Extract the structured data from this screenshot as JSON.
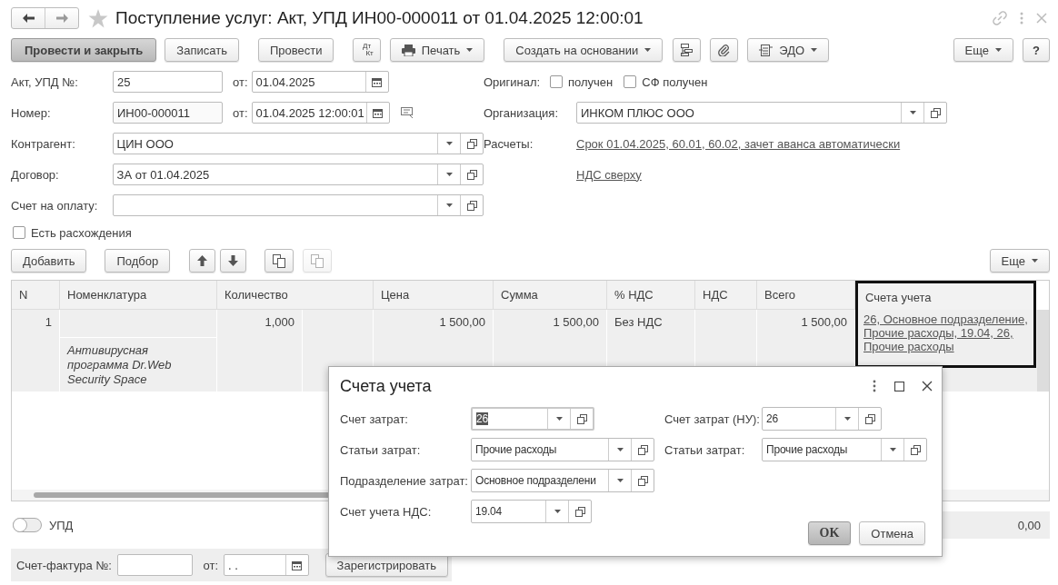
{
  "window": {
    "title": "Поступление услуг: Акт, УПД ИН00-000011 от 01.04.2025 12:00:01"
  },
  "toolbar": [
    {
      "kind": "primary",
      "label": "Провести и закрыть"
    },
    {
      "kind": "button",
      "label": "Записать"
    },
    {
      "kind": "button",
      "label": "Провести"
    },
    {
      "kind": "dtkt",
      "label": "Дт",
      "sublabel": "Кт"
    },
    {
      "kind": "print",
      "label": "Печать"
    },
    {
      "kind": "menu",
      "label": "Создать на основании"
    },
    {
      "kind": "structure"
    },
    {
      "kind": "attach"
    },
    {
      "kind": "edo",
      "label": "ЭДО"
    }
  ],
  "toolbar_right": [
    {
      "kind": "menu",
      "label": "Еще"
    },
    {
      "kind": "button",
      "label": "?"
    }
  ],
  "form_left": [
    {
      "kind": "text",
      "label": "Акт, УПД №:",
      "value": "25",
      "date_label": "от:",
      "date": "01.04.2025"
    },
    {
      "kind": "readonly",
      "label": "Номер:",
      "value": "ИН00-000011",
      "date_label": "от:",
      "date": "01.04.2025 12:00:01"
    },
    {
      "kind": "select",
      "label": "Контрагент:",
      "value": "ЦИН ООО"
    },
    {
      "kind": "select",
      "label": "Договор:",
      "value": "ЗА от 01.04.2025"
    },
    {
      "kind": "select",
      "label": "Счет на оплату:"
    }
  ],
  "form_right": [
    {
      "kind": "checks",
      "label": "Оригинал:",
      "checks": [
        {
          "label": "получен",
          "checked": false
        },
        {
          "label": "СФ получен",
          "checked": false
        }
      ]
    },
    {
      "kind": "select",
      "label": "Организация:",
      "value": "ИНКОМ ПЛЮС ООО"
    },
    {
      "kind": "link",
      "label": "Расчеты:",
      "value": "Срок 01.04.2025, 60.01, 60.02, зачет аванса автоматически"
    },
    {
      "kind": "link",
      "value": "НДС сверху"
    }
  ],
  "discrepancy": {
    "label": "Есть расхождения",
    "checked": false
  },
  "table_toolbar": [
    {
      "kind": "button",
      "label": "Добавить"
    },
    {
      "kind": "button",
      "label": "Подбор"
    },
    {
      "kind": "up"
    },
    {
      "kind": "down"
    },
    {
      "kind": "copy"
    },
    {
      "kind": "paste",
      "disabled": true
    }
  ],
  "table_toolbar_right": {
    "label": "Еще"
  },
  "table": {
    "columns": [
      {
        "label": "N",
        "highlighted": false
      },
      {
        "label": "Номенклатура",
        "highlighted": false
      },
      {
        "label": "Количество",
        "highlighted": false
      },
      {
        "label": "Цена",
        "highlighted": false
      },
      {
        "label": "Сумма",
        "highlighted": false
      },
      {
        "label": "% НДС",
        "highlighted": false
      },
      {
        "label": "НДС",
        "highlighted": false
      },
      {
        "label": "Всего",
        "highlighted": false
      },
      {
        "label": "Счета учета",
        "highlighted": true
      }
    ],
    "rows": [
      {
        "selected": true,
        "n": "1",
        "item_description": "Антивирусная программа Dr.Web Security Space",
        "quantity": "1,000",
        "price": "1 500,00",
        "sum": "1 500,00",
        "vat_rate": "Без НДС",
        "total": "1 500,00",
        "accounts": "26, Основное подразделение, Прочие расходы, 19.04, 26, Прочие расходы"
      }
    ]
  },
  "upd_toggle": {
    "label": "УПД",
    "on": false
  },
  "total": "0,00",
  "invoice": {
    "label": "Счет-фактура №:",
    "date_label": "от:",
    "date": " .  .",
    "button": "Зарегистрировать"
  },
  "dialog": {
    "title": "Счета учета",
    "left": [
      {
        "label": "Счет затрат:",
        "value": "26",
        "focused": true
      },
      {
        "label": "Статьи затрат:",
        "value": "Прочие расходы",
        "focused": false
      },
      {
        "label": "Подразделение затрат:",
        "value": "Основное подразделени",
        "focused": false
      },
      {
        "label": "Счет учета НДС:",
        "value": "19.04",
        "focused": false
      }
    ],
    "right": [
      {
        "label": "Счет затрат (НУ):",
        "value": "26",
        "focused": false
      },
      {
        "label": "Статьи затрат:",
        "value": "Прочие расходы",
        "focused": false
      }
    ],
    "buttons": [
      {
        "kind": "default",
        "label": "OK"
      },
      {
        "kind": "button",
        "label": "Отмена"
      }
    ]
  }
}
